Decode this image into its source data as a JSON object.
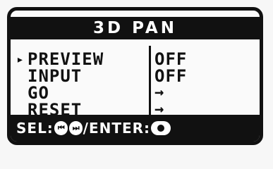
{
  "screen": {
    "title": "3D PAN",
    "menu": [
      {
        "label": "PREVIEW",
        "value": "OFF",
        "selected": true
      },
      {
        "label": "INPUT",
        "value": "OFF",
        "selected": false
      },
      {
        "label": "GO",
        "value": "→",
        "selected": false
      },
      {
        "label": "RESET",
        "value": "→",
        "selected": false
      }
    ],
    "cursor_glyph": "▸",
    "status": {
      "sel_label": "SEL:",
      "rewind_icon": "⏮",
      "ffwd_icon": "⏭",
      "separator": "/",
      "enter_label": "ENTER:"
    }
  }
}
